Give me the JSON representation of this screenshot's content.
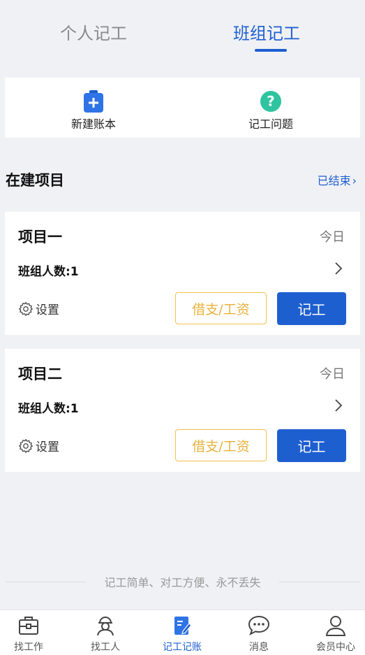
{
  "tabs": {
    "personal": "个人记工",
    "team": "班组记工"
  },
  "quick_actions": {
    "new_ledger": "新建账本",
    "faq": "记工问题",
    "faq_icon_glyph": "?"
  },
  "section": {
    "title": "在建项目",
    "ended_link": "已结束"
  },
  "projects": [
    {
      "name": "项目一",
      "date": "今日",
      "member_count": "班组人数:1",
      "settings": "设置",
      "loan_button": "借支/工资",
      "record_button": "记工"
    },
    {
      "name": "项目二",
      "date": "今日",
      "member_count": "班组人数:1",
      "settings": "设置",
      "loan_button": "借支/工资",
      "record_button": "记工"
    }
  ],
  "slogan": "记工简单、对工方便、永不丢失",
  "bottom_nav": {
    "items": [
      {
        "label": "找工作",
        "icon": "briefcase-icon"
      },
      {
        "label": "找工人",
        "icon": "worker-icon"
      },
      {
        "label": "记工记账",
        "icon": "notebook-pen-icon"
      },
      {
        "label": "消息",
        "icon": "chat-icon"
      },
      {
        "label": "会员中心",
        "icon": "user-icon"
      }
    ],
    "active_index": 2
  },
  "colors": {
    "accent": "#1e5fd0",
    "loan_button": "#f2c24a",
    "faq_icon": "#2ec4a0",
    "background": "#f0f1f5"
  }
}
